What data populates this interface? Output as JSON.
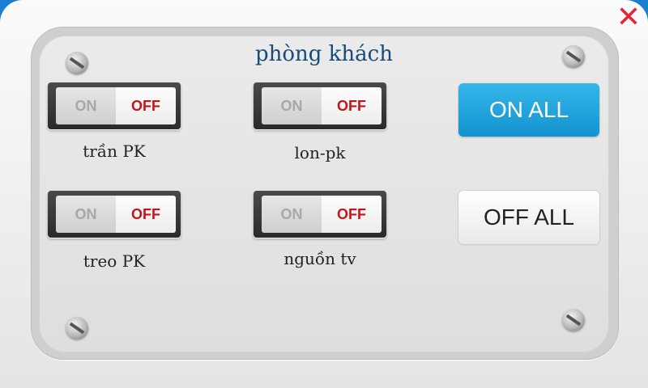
{
  "panel": {
    "title": "phòng khách",
    "close_glyph": "✕"
  },
  "switches": [
    {
      "name": "trần PK",
      "on_label": "ON",
      "off_label": "OFF",
      "state": "off"
    },
    {
      "name": "lon-pk",
      "on_label": "ON",
      "off_label": "OFF",
      "state": "off"
    },
    {
      "name": "treo PK",
      "on_label": "ON",
      "off_label": "OFF",
      "state": "off"
    },
    {
      "name": "nguồn tv",
      "on_label": "ON",
      "off_label": "OFF",
      "state": "off"
    }
  ],
  "actions": {
    "on_all_label": "ON ALL",
    "off_all_label": "OFF ALL"
  },
  "colors": {
    "accent_blue": "#1a7fd1",
    "title_blue": "#164b7c",
    "off_red": "#c4151b",
    "close_red": "#e3243b"
  }
}
